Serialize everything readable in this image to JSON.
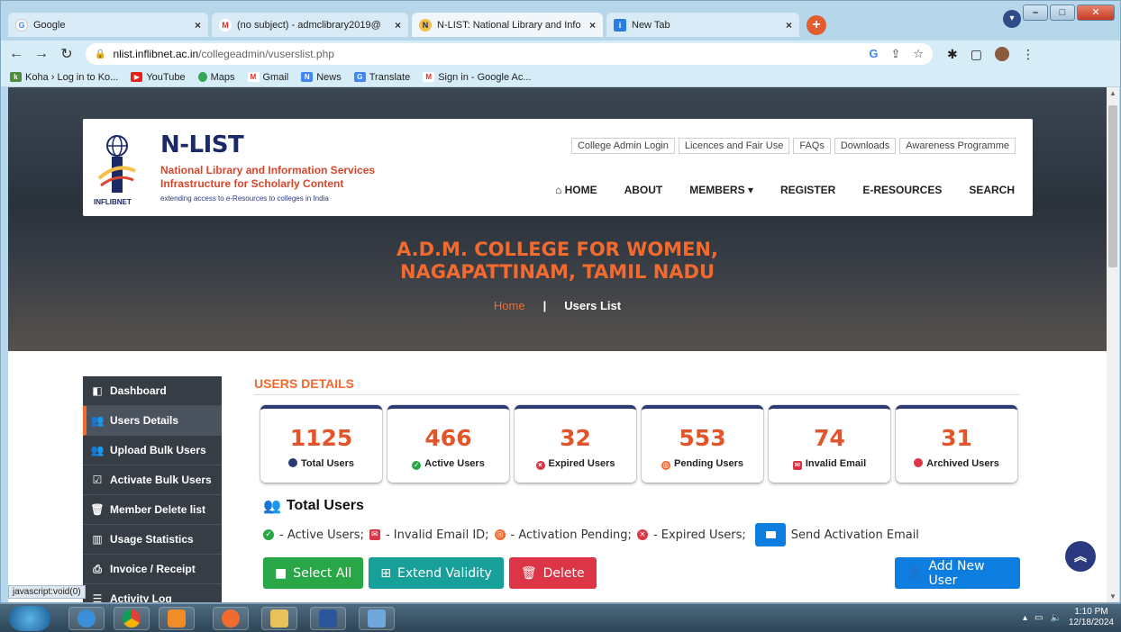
{
  "browser": {
    "tabs": [
      {
        "title": "Google",
        "active": false
      },
      {
        "title": "(no subject) - admclibrary2019@",
        "active": false
      },
      {
        "title": "N-LIST: National Library and Info",
        "active": true
      },
      {
        "title": "New Tab",
        "active": false
      }
    ],
    "url_host": "nlist.inflibnet.ac.in",
    "url_path": "/collegeadmin/vuserslist.php",
    "bookmarks": [
      "Koha › Log in to Ko...",
      "YouTube",
      "Maps",
      "Gmail",
      "News",
      "Translate",
      "Sign in - Google Ac..."
    ],
    "status_text": "javascript:void(0)"
  },
  "site": {
    "logo_title": "N-LIST",
    "logo_sub1": "National Library and Information Services",
    "logo_sub2": "Infrastructure for Scholarly Content",
    "logo_tagline": "extending access to e-Resources to colleges in India",
    "logo_org": "INFLIBNET",
    "top_links": [
      "College Admin Login",
      "Licences and Fair Use",
      "FAQs",
      "Downloads",
      "Awareness Programme"
    ],
    "nav": [
      "HOME",
      "ABOUT",
      "MEMBERS",
      "REGISTER",
      "E-RESOURCES",
      "SEARCH"
    ],
    "college_line1": "A.D.M. COLLEGE FOR WOMEN,",
    "college_line2": "NAGAPATTINAM, TAMIL NADU",
    "breadcrumb_home": "Home",
    "breadcrumb_sep": "|",
    "breadcrumb_current": "Users List"
  },
  "sidebar": {
    "items": [
      {
        "label": "Dashboard",
        "icon": "dashboard-icon"
      },
      {
        "label": "Users Details",
        "icon": "users-icon",
        "active": true
      },
      {
        "label": "Upload Bulk Users",
        "icon": "upload-users-icon"
      },
      {
        "label": "Activate Bulk Users",
        "icon": "check-square-icon"
      },
      {
        "label": "Member Delete list",
        "icon": "trash-icon"
      },
      {
        "label": "Usage Statistics",
        "icon": "bar-chart-icon"
      },
      {
        "label": "Invoice / Receipt",
        "icon": "print-icon"
      },
      {
        "label": "Activity Log",
        "icon": "list-icon"
      }
    ]
  },
  "main": {
    "section_title": "USERS DETAILS",
    "stats": [
      {
        "value": "1125",
        "label": "Total Users",
        "icon": "users-icon",
        "color": "#2b3a70"
      },
      {
        "value": "466",
        "label": "Active Users",
        "icon": "check-circle-icon",
        "color": "#27a745"
      },
      {
        "value": "32",
        "label": "Expired Users",
        "icon": "times-circle-icon",
        "color": "#dc3545"
      },
      {
        "value": "553",
        "label": "Pending Users",
        "icon": "pending-icon",
        "color": "#f26a2e"
      },
      {
        "value": "74",
        "label": "Invalid Email",
        "icon": "envelope-x-icon",
        "color": "#dc3545"
      },
      {
        "value": "31",
        "label": "Archived Users",
        "icon": "user-x-icon",
        "color": "#dc3545"
      }
    ],
    "total_heading": "Total Users",
    "legend": {
      "active": "- Active Users;",
      "invalid": "- Invalid Email ID;",
      "pending": "- Activation Pending;",
      "expired": "- Expired Users;",
      "send": "Send Activation Email"
    },
    "buttons": {
      "select_all": "Select All",
      "extend": "Extend Validity",
      "delete": "Delete",
      "add_user": "Add New User"
    }
  },
  "taskbar": {
    "time": "1:10 PM",
    "date": "12/18/2024"
  }
}
